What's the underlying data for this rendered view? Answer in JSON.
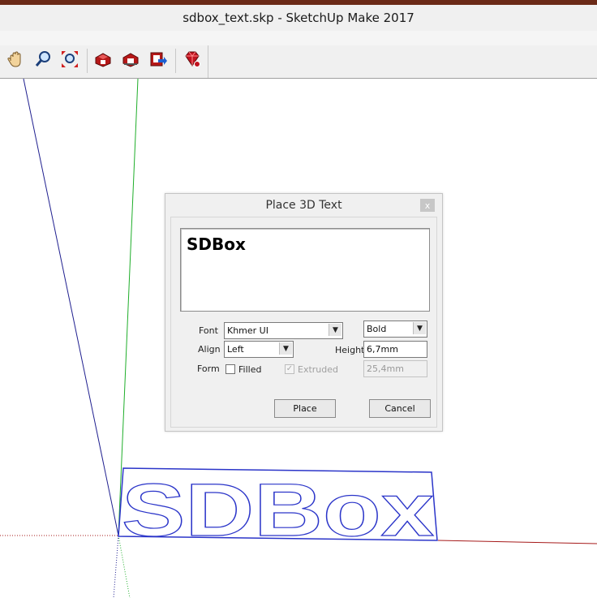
{
  "window": {
    "title": "sdbox_text.skp - SketchUp Make 2017"
  },
  "toolbar": {
    "buttons": [
      "pan-icon",
      "zoom-icon",
      "zoom-extents-icon",
      "3d-warehouse-icon",
      "share-model-icon",
      "share-component-icon",
      "extension-warehouse-icon"
    ]
  },
  "dialog": {
    "title": "Place 3D Text",
    "close_label": "x",
    "text_value": "SDBox",
    "font": {
      "label": "Font",
      "value": "Khmer UI"
    },
    "style": {
      "value": "Bold"
    },
    "align": {
      "label": "Align",
      "value": "Left"
    },
    "height": {
      "label": "Height",
      "value": "6,7mm"
    },
    "form": {
      "label": "Form"
    },
    "filled": {
      "label": "Filled",
      "checked": false
    },
    "extruded": {
      "label": "Extruded",
      "checked": true,
      "enabled": false,
      "value": "25,4mm"
    },
    "place_label": "Place",
    "cancel_label": "Cancel"
  },
  "scene": {
    "model_text": "SDBox",
    "text_color": "#2b35c9"
  }
}
